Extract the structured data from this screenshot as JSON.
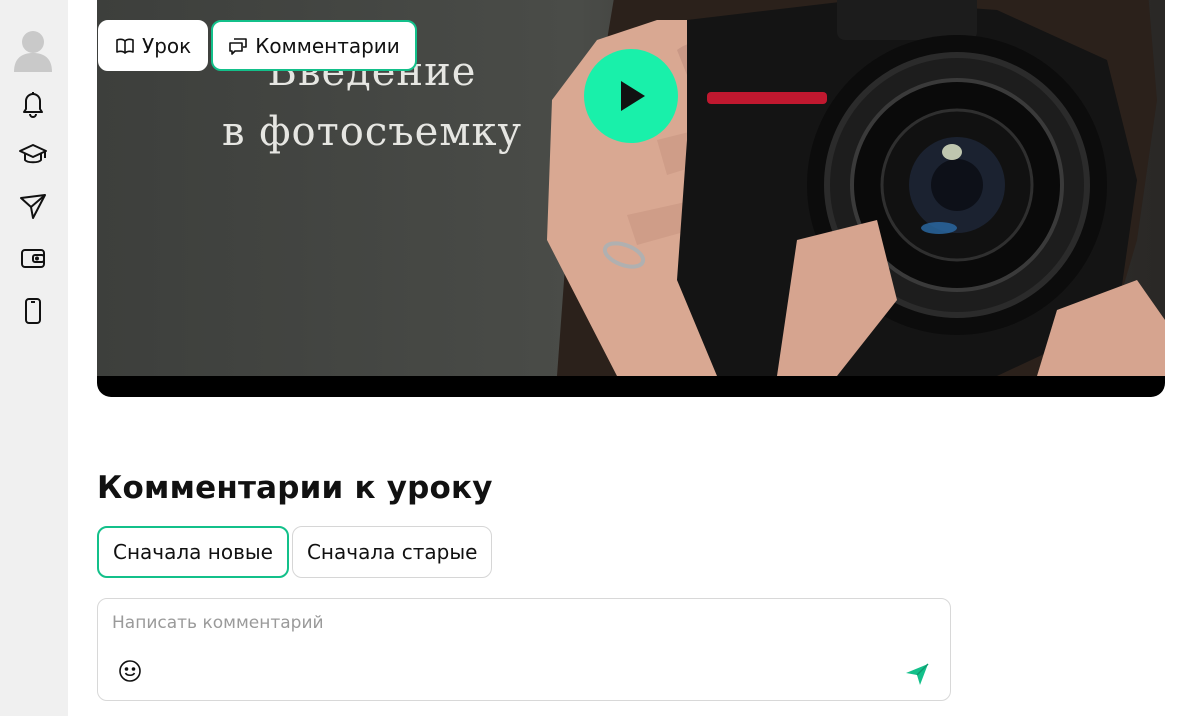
{
  "sidebar": {
    "items": [
      {
        "icon": "avatar-icon"
      },
      {
        "icon": "bell-icon"
      },
      {
        "icon": "graduation-cap-icon"
      },
      {
        "icon": "send-icon"
      },
      {
        "icon": "wallet-icon"
      },
      {
        "icon": "phone-icon"
      }
    ]
  },
  "video": {
    "title_line1": "Введение",
    "title_line2": "в фотосъемку"
  },
  "tabs": [
    {
      "label": "Урок",
      "icon": "book-icon",
      "active": false
    },
    {
      "label": "Комментарии",
      "icon": "comments-icon",
      "active": true
    }
  ],
  "comments": {
    "heading": "Комментарии к уроку",
    "sort": [
      {
        "label": "Сначала новые",
        "active": true
      },
      {
        "label": "Сначала старые",
        "active": false
      }
    ],
    "input_placeholder": "Написать комментарий"
  },
  "colors": {
    "accent": "#13c08a",
    "play_button": "#19f0aa",
    "sidebar_bg": "#f0f0f0"
  }
}
